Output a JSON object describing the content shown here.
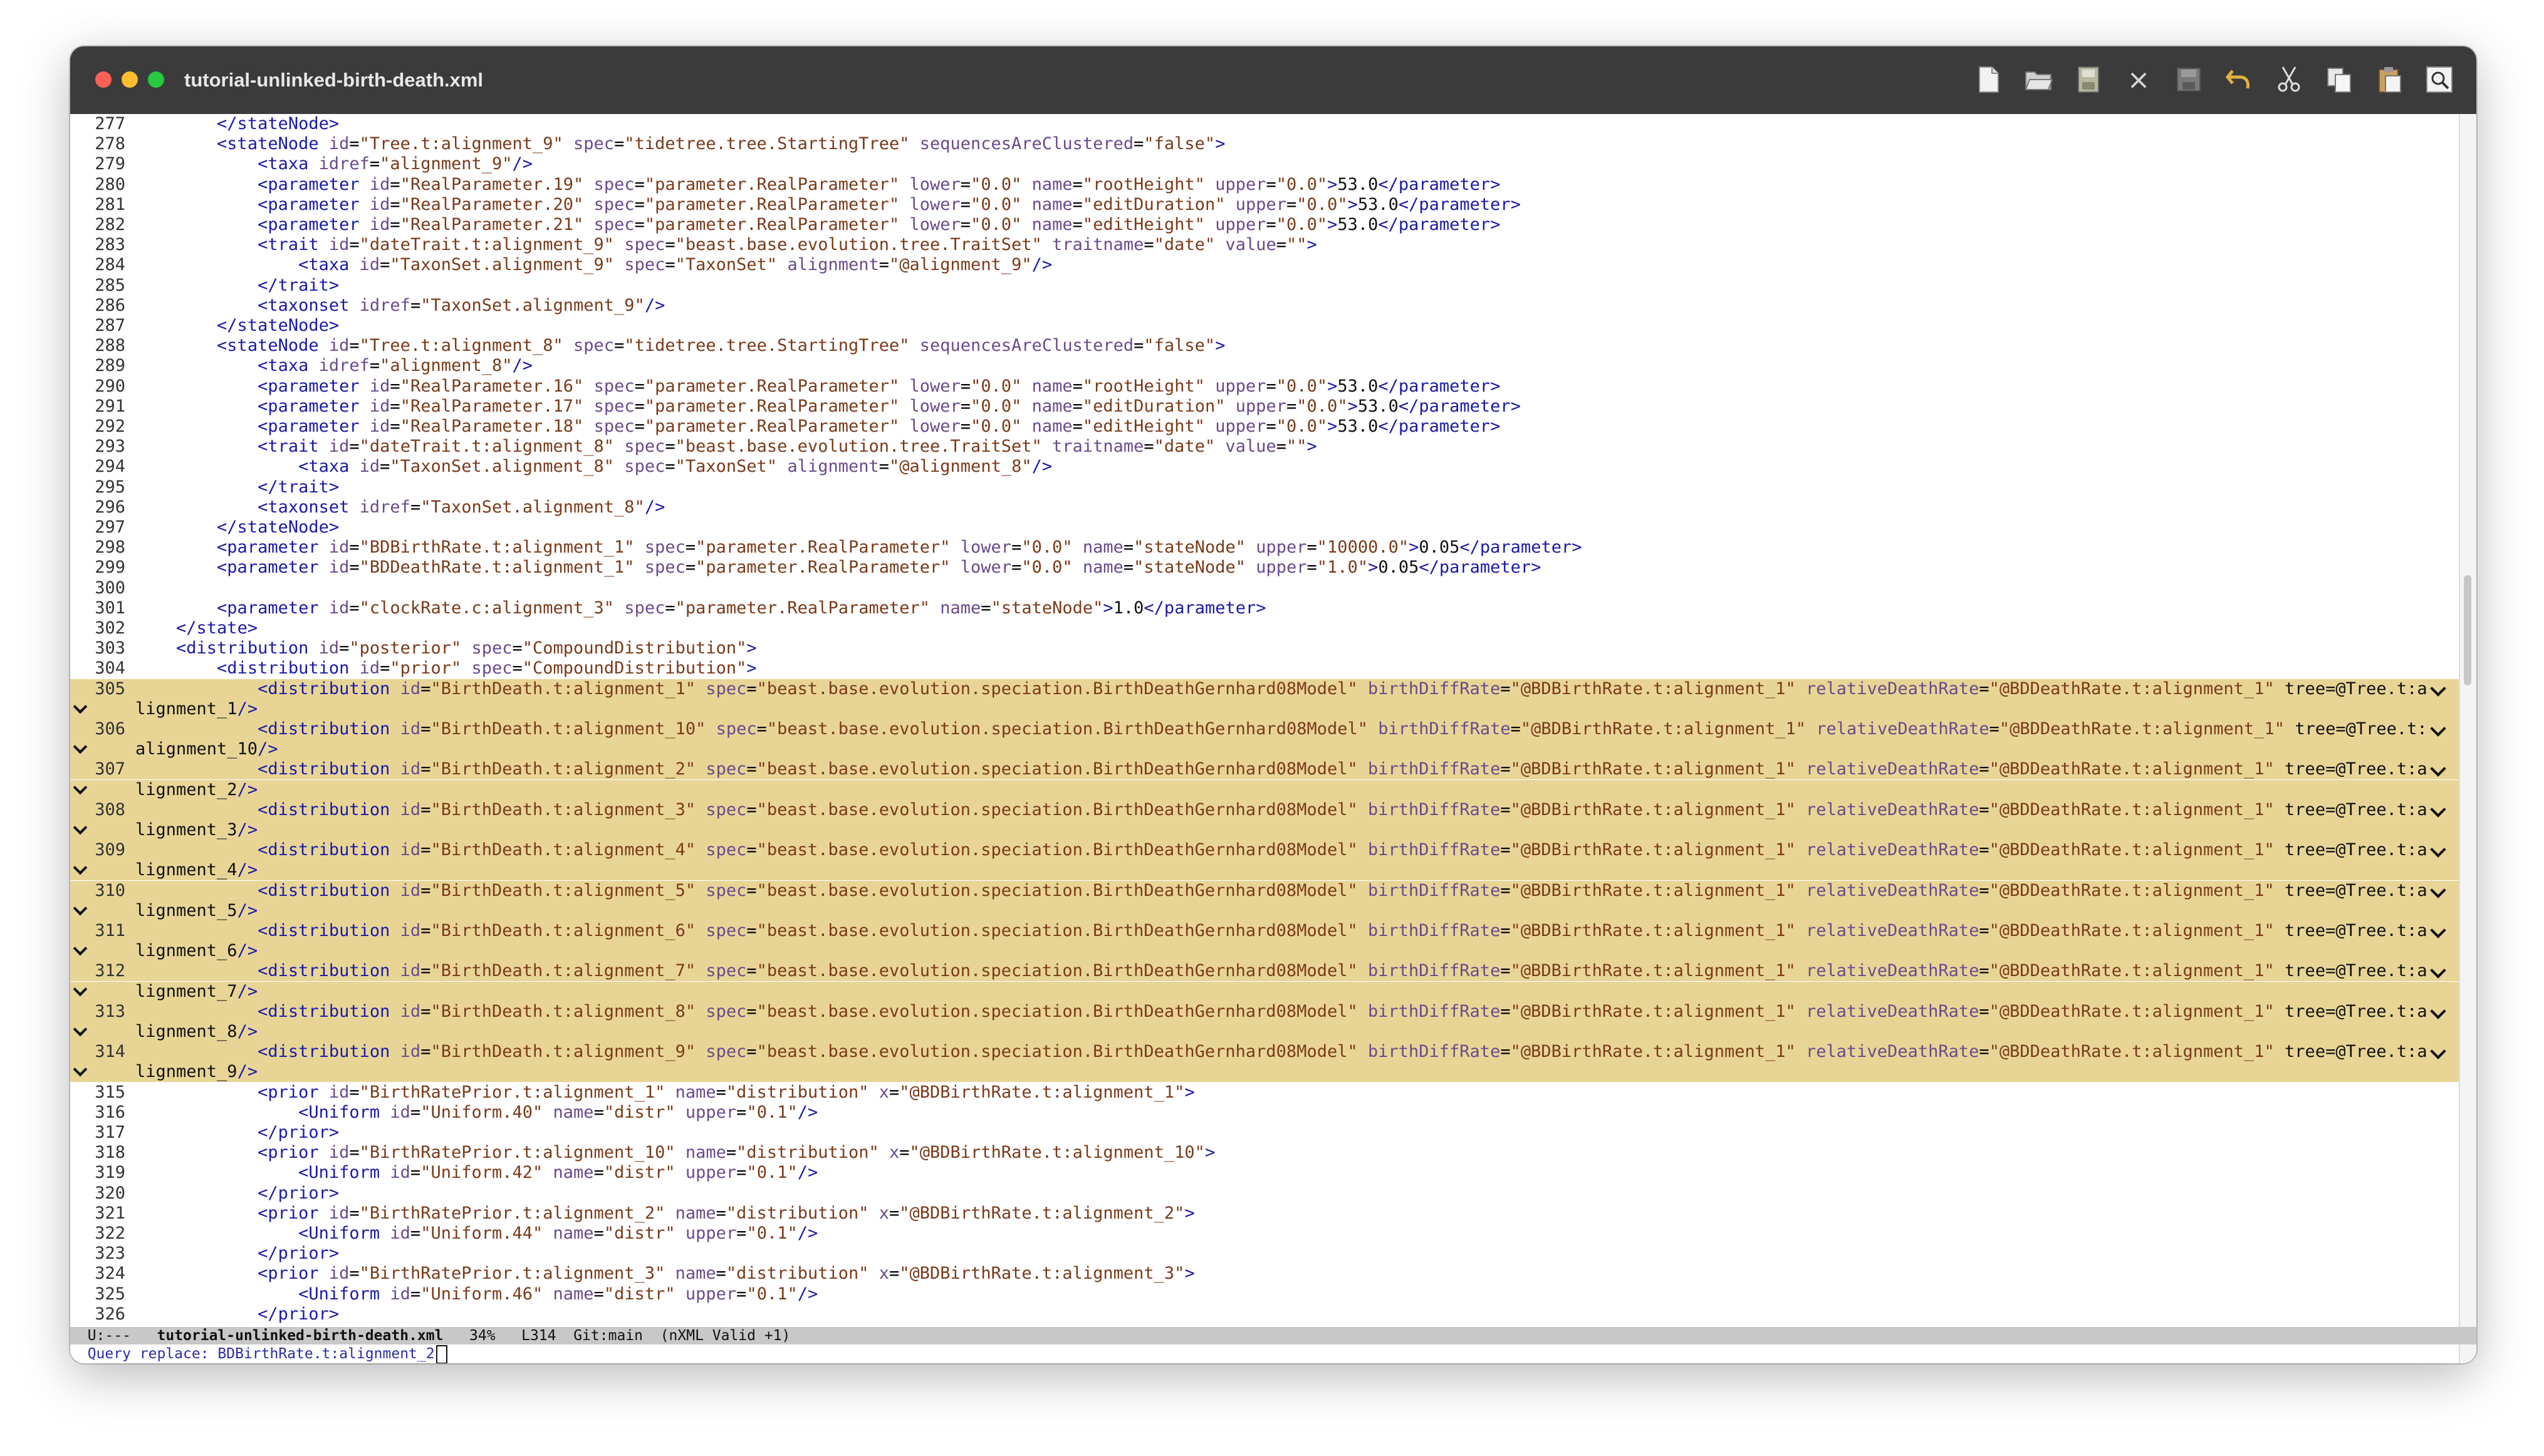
{
  "window": {
    "title": "tutorial-unlinked-birth-death.xml"
  },
  "toolbar": {
    "icons": [
      "new-file-icon",
      "open-folder-icon",
      "save-icon",
      "close-icon",
      "save-as-icon",
      "undo-icon",
      "cut-icon",
      "copy-icon",
      "paste-icon",
      "search-icon"
    ],
    "close_glyph": "×"
  },
  "lines": [
    {
      "n": "277",
      "text": "        </stateNode>"
    },
    {
      "n": "278",
      "text": "        <stateNode id=\"Tree.t:alignment_9\" spec=\"tidetree.tree.StartingTree\" sequencesAreClustered=\"false\">"
    },
    {
      "n": "279",
      "text": "            <taxa idref=\"alignment_9\"/>"
    },
    {
      "n": "280",
      "text": "            <parameter id=\"RealParameter.19\" spec=\"parameter.RealParameter\" lower=\"0.0\" name=\"rootHeight\" upper=\"0.0\">53.0</parameter>"
    },
    {
      "n": "281",
      "text": "            <parameter id=\"RealParameter.20\" spec=\"parameter.RealParameter\" lower=\"0.0\" name=\"editDuration\" upper=\"0.0\">53.0</parameter>"
    },
    {
      "n": "282",
      "text": "            <parameter id=\"RealParameter.21\" spec=\"parameter.RealParameter\" lower=\"0.0\" name=\"editHeight\" upper=\"0.0\">53.0</parameter>"
    },
    {
      "n": "283",
      "text": "            <trait id=\"dateTrait.t:alignment_9\" spec=\"beast.base.evolution.tree.TraitSet\" traitname=\"date\" value=\"\">"
    },
    {
      "n": "284",
      "text": "                <taxa id=\"TaxonSet.alignment_9\" spec=\"TaxonSet\" alignment=\"@alignment_9\"/>"
    },
    {
      "n": "285",
      "text": "            </trait>"
    },
    {
      "n": "286",
      "text": "            <taxonset idref=\"TaxonSet.alignment_9\"/>"
    },
    {
      "n": "287",
      "text": "        </stateNode>"
    },
    {
      "n": "288",
      "text": "        <stateNode id=\"Tree.t:alignment_8\" spec=\"tidetree.tree.StartingTree\" sequencesAreClustered=\"false\">"
    },
    {
      "n": "289",
      "text": "            <taxa idref=\"alignment_8\"/>"
    },
    {
      "n": "290",
      "text": "            <parameter id=\"RealParameter.16\" spec=\"parameter.RealParameter\" lower=\"0.0\" name=\"rootHeight\" upper=\"0.0\">53.0</parameter>"
    },
    {
      "n": "291",
      "text": "            <parameter id=\"RealParameter.17\" spec=\"parameter.RealParameter\" lower=\"0.0\" name=\"editDuration\" upper=\"0.0\">53.0</parameter>"
    },
    {
      "n": "292",
      "text": "            <parameter id=\"RealParameter.18\" spec=\"parameter.RealParameter\" lower=\"0.0\" name=\"editHeight\" upper=\"0.0\">53.0</parameter>"
    },
    {
      "n": "293",
      "text": "            <trait id=\"dateTrait.t:alignment_8\" spec=\"beast.base.evolution.tree.TraitSet\" traitname=\"date\" value=\"\">"
    },
    {
      "n": "294",
      "text": "                <taxa id=\"TaxonSet.alignment_8\" spec=\"TaxonSet\" alignment=\"@alignment_8\"/>"
    },
    {
      "n": "295",
      "text": "            </trait>"
    },
    {
      "n": "296",
      "text": "            <taxonset idref=\"TaxonSet.alignment_8\"/>"
    },
    {
      "n": "297",
      "text": "        </stateNode>"
    },
    {
      "n": "298",
      "text": "        <parameter id=\"BDBirthRate.t:alignment_1\" spec=\"parameter.RealParameter\" lower=\"0.0\" name=\"stateNode\" upper=\"10000.0\">0.05</parameter>"
    },
    {
      "n": "299",
      "text": "        <parameter id=\"BDDeathRate.t:alignment_1\" spec=\"parameter.RealParameter\" lower=\"0.0\" name=\"stateNode\" upper=\"1.0\">0.05</parameter>"
    },
    {
      "n": "300",
      "text": ""
    },
    {
      "n": "301",
      "text": "        <parameter id=\"clockRate.c:alignment_3\" spec=\"parameter.RealParameter\" name=\"stateNode\">1.0</parameter>"
    },
    {
      "n": "302",
      "text": "    </state>"
    },
    {
      "n": "303",
      "text": "    <distribution id=\"posterior\" spec=\"CompoundDistribution\">"
    },
    {
      "n": "304",
      "text": "        <distribution id=\"prior\" spec=\"CompoundDistribution\">"
    },
    {
      "n": "305",
      "text": "            <distribution id=\"BirthDeath.t:alignment_1\" spec=\"beast.base.evolution.speciation.BirthDeathGernhard08Model\" birthDiffRate=\"@BDBirthRate.t:alignment_1\" relativeDeathRate=\"@BDDeathRate.t:alignment_1\" tree=\"@Tree.t:a",
      "wrap": "lignment_1\"/>",
      "hl": true
    },
    {
      "n": "306",
      "text": "            <distribution id=\"BirthDeath.t:alignment_10\" spec=\"beast.base.evolution.speciation.BirthDeathGernhard08Model\" birthDiffRate=\"@BDBirthRate.t:alignment_1\" relativeDeathRate=\"@BDDeathRate.t:alignment_1\" tree=\"@Tree.t:",
      "wrap": "alignment_10\"/>",
      "hl": true
    },
    {
      "n": "307",
      "text": "            <distribution id=\"BirthDeath.t:alignment_2\" spec=\"beast.base.evolution.speciation.BirthDeathGernhard08Model\" birthDiffRate=\"@BDBirthRate.t:alignment_1\" relativeDeathRate=\"@BDDeathRate.t:alignment_1\" tree=\"@Tree.t:a",
      "wrap": "lignment_2\"/>",
      "hl": true
    },
    {
      "n": "308",
      "text": "            <distribution id=\"BirthDeath.t:alignment_3\" spec=\"beast.base.evolution.speciation.BirthDeathGernhard08Model\" birthDiffRate=\"@BDBirthRate.t:alignment_1\" relativeDeathRate=\"@BDDeathRate.t:alignment_1\" tree=\"@Tree.t:a",
      "wrap": "lignment_3\"/>",
      "hl": true
    },
    {
      "n": "309",
      "text": "            <distribution id=\"BirthDeath.t:alignment_4\" spec=\"beast.base.evolution.speciation.BirthDeathGernhard08Model\" birthDiffRate=\"@BDBirthRate.t:alignment_1\" relativeDeathRate=\"@BDDeathRate.t:alignment_1\" tree=\"@Tree.t:a",
      "wrap": "lignment_4\"/>",
      "hl": true
    },
    {
      "n": "310",
      "text": "            <distribution id=\"BirthDeath.t:alignment_5\" spec=\"beast.base.evolution.speciation.BirthDeathGernhard08Model\" birthDiffRate=\"@BDBirthRate.t:alignment_1\" relativeDeathRate=\"@BDDeathRate.t:alignment_1\" tree=\"@Tree.t:a",
      "wrap": "lignment_5\"/>",
      "hl": true
    },
    {
      "n": "311",
      "text": "            <distribution id=\"BirthDeath.t:alignment_6\" spec=\"beast.base.evolution.speciation.BirthDeathGernhard08Model\" birthDiffRate=\"@BDBirthRate.t:alignment_1\" relativeDeathRate=\"@BDDeathRate.t:alignment_1\" tree=\"@Tree.t:a",
      "wrap": "lignment_6\"/>",
      "hl": true
    },
    {
      "n": "312",
      "text": "            <distribution id=\"BirthDeath.t:alignment_7\" spec=\"beast.base.evolution.speciation.BirthDeathGernhard08Model\" birthDiffRate=\"@BDBirthRate.t:alignment_1\" relativeDeathRate=\"@BDDeathRate.t:alignment_1\" tree=\"@Tree.t:a",
      "wrap": "lignment_7\"/>",
      "hl": true
    },
    {
      "n": "313",
      "text": "            <distribution id=\"BirthDeath.t:alignment_8\" spec=\"beast.base.evolution.speciation.BirthDeathGernhard08Model\" birthDiffRate=\"@BDBirthRate.t:alignment_1\" relativeDeathRate=\"@BDDeathRate.t:alignment_1\" tree=\"@Tree.t:a",
      "wrap": "lignment_8\"/>",
      "hl": true
    },
    {
      "n": "314",
      "text": "            <distribution id=\"BirthDeath.t:alignment_9\" spec=\"beast.base.evolution.speciation.BirthDeathGernhard08Model\" birthDiffRate=\"@BDBirthRate.t:alignment_1\" relativeDeathRate=\"@BDDeathRate.t:alignment_1\" tree=\"@Tree.t:a",
      "wrap": "lignment_9\"/>",
      "hl": true
    },
    {
      "n": "315",
      "text": "            <prior id=\"BirthRatePrior.t:alignment_1\" name=\"distribution\" x=\"@BDBirthRate.t:alignment_1\">"
    },
    {
      "n": "316",
      "text": "                <Uniform id=\"Uniform.40\" name=\"distr\" upper=\"0.1\"/>"
    },
    {
      "n": "317",
      "text": "            </prior>"
    },
    {
      "n": "318",
      "text": "            <prior id=\"BirthRatePrior.t:alignment_10\" name=\"distribution\" x=\"@BDBirthRate.t:alignment_10\">"
    },
    {
      "n": "319",
      "text": "                <Uniform id=\"Uniform.42\" name=\"distr\" upper=\"0.1\"/>"
    },
    {
      "n": "320",
      "text": "            </prior>"
    },
    {
      "n": "321",
      "text": "            <prior id=\"BirthRatePrior.t:alignment_2\" name=\"distribution\" x=\"@BDBirthRate.t:alignment_2\">"
    },
    {
      "n": "322",
      "text": "                <Uniform id=\"Uniform.44\" name=\"distr\" upper=\"0.1\"/>"
    },
    {
      "n": "323",
      "text": "            </prior>"
    },
    {
      "n": "324",
      "text": "            <prior id=\"BirthRatePrior.t:alignment_3\" name=\"distribution\" x=\"@BDBirthRate.t:alignment_3\">"
    },
    {
      "n": "325",
      "text": "                <Uniform id=\"Uniform.46\" name=\"distr\" upper=\"0.1\"/>"
    },
    {
      "n": "326",
      "text": "            </prior>"
    }
  ],
  "modeline": {
    "status": "U:---",
    "buffer": "tutorial-unlinked-birth-death.xml",
    "percent": "34%",
    "line": "L314",
    "git": "Git:main",
    "mode": "(nXML Valid +1)"
  },
  "minibuffer": {
    "prompt": "Query replace: ",
    "input": "BDBirthRate.t:alignment_2"
  },
  "colors": {
    "highlight": "#e8d596",
    "tag": "#1a1aa6",
    "attribute": "#6a4a8c",
    "string": "#7a3a1a",
    "titlebar": "#3b3b3b",
    "traffic_red": "#fe5f57",
    "traffic_yellow": "#febc2e",
    "traffic_green": "#28c840"
  }
}
